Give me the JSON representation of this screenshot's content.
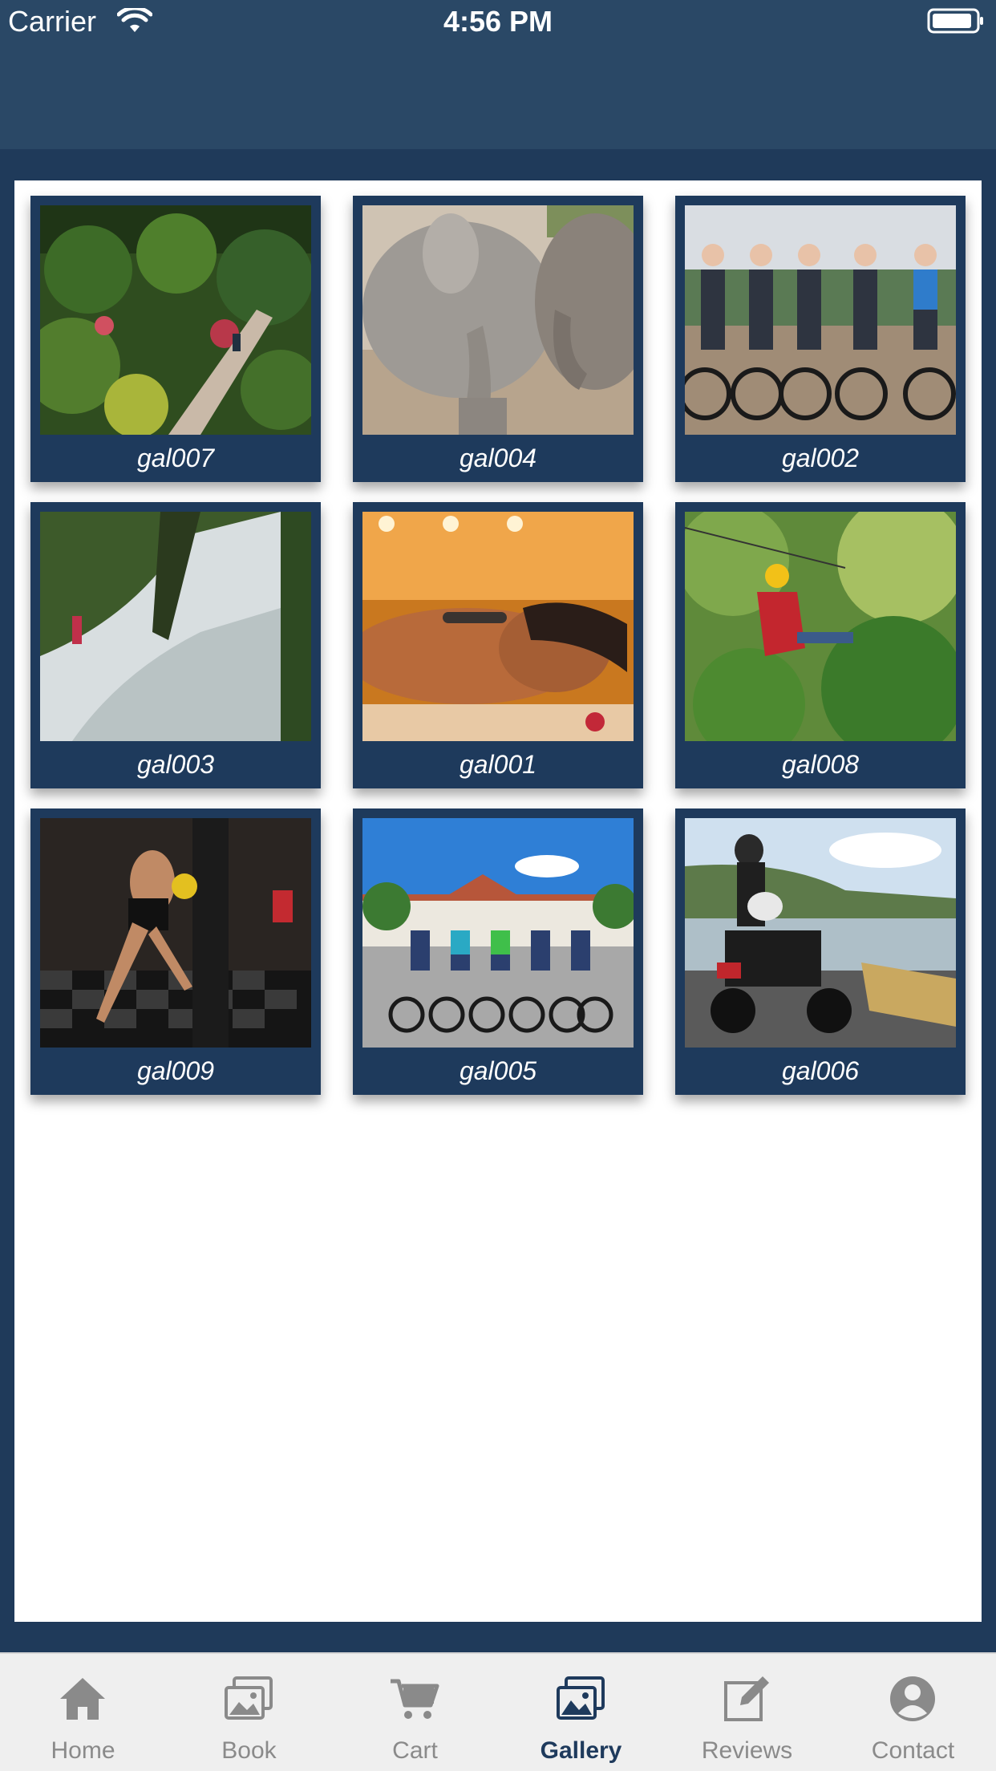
{
  "status_bar": {
    "carrier": "Carrier",
    "time": "4:56 PM",
    "wifi_icon": "wifi-icon",
    "battery_icon": "battery-icon"
  },
  "gallery": {
    "items": [
      {
        "caption": "gal007",
        "photo": "garden-path-cyclist"
      },
      {
        "caption": "gal004",
        "photo": "two-elephants"
      },
      {
        "caption": "gal002",
        "photo": "group-with-bicycles"
      },
      {
        "caption": "gal003",
        "photo": "waterfall-climber"
      },
      {
        "caption": "gal001",
        "photo": "spa-hot-stone-massage"
      },
      {
        "caption": "gal008",
        "photo": "zipline-jungle"
      },
      {
        "caption": "gal009",
        "photo": "muay-thai-training"
      },
      {
        "caption": "gal005",
        "photo": "cyclists-in-front-of-building"
      },
      {
        "caption": "gal006",
        "photo": "atv-by-lake"
      }
    ]
  },
  "tab_bar": {
    "tabs": [
      {
        "label": "Home",
        "icon": "home-icon",
        "active": false
      },
      {
        "label": "Book",
        "icon": "images-icon",
        "active": false
      },
      {
        "label": "Cart",
        "icon": "cart-icon",
        "active": false
      },
      {
        "label": "Gallery",
        "icon": "gallery-icon",
        "active": true
      },
      {
        "label": "Reviews",
        "icon": "edit-icon",
        "active": false
      },
      {
        "label": "Contact",
        "icon": "user-icon",
        "active": false
      }
    ]
  },
  "colors": {
    "brand": "#1e3a5c",
    "nav": "#2a4866",
    "tab_inactive": "#8a8a8a",
    "background": "#ffffff"
  }
}
